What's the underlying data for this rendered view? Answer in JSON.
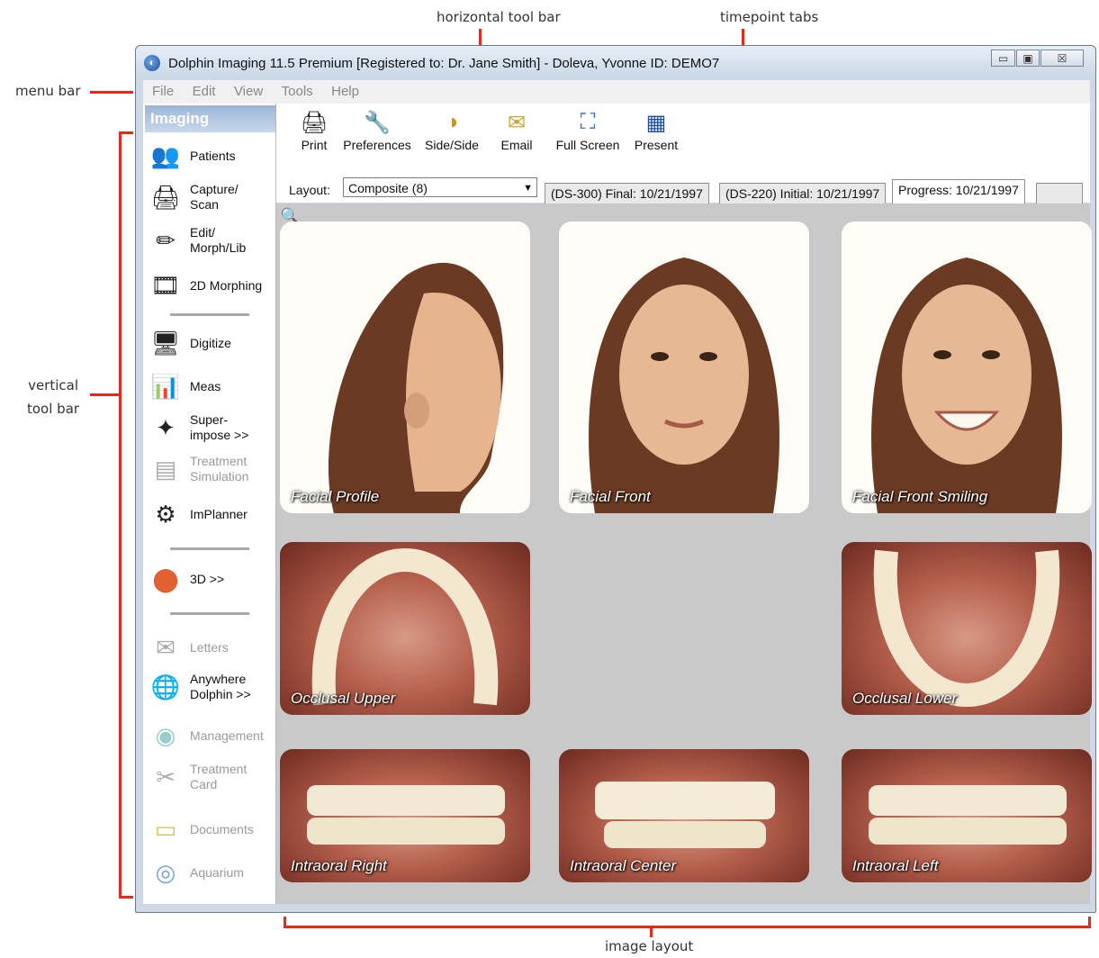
{
  "callouts": {
    "menu_bar": "menu bar",
    "horizontal_tool_bar": "horizontal tool bar",
    "timepoint_tabs": "timepoint tabs",
    "vertical_tool_bar": "vertical\ntool bar",
    "image_layout": "image layout"
  },
  "window": {
    "title": "Dolphin Imaging 11.5 Premium [Registered to: Dr. Jane Smith] - Doleva, Yvonne  ID: DEMO7",
    "app_icon": "dolphin-icon",
    "controls": {
      "minimize": "▭",
      "maximize": "▣",
      "close": "☒"
    }
  },
  "menu": [
    "File",
    "Edit",
    "View",
    "Tools",
    "Help"
  ],
  "sidebar": {
    "header": "Imaging",
    "items": [
      {
        "label": "Patients",
        "icon": "patients-icon",
        "glyph": "👥",
        "enabled": true
      },
      {
        "label": "Capture/\nScan",
        "icon": "scanner-icon",
        "glyph": "🖨",
        "enabled": true
      },
      {
        "label": "Edit/\nMorph/Lib",
        "icon": "pencils-icon",
        "glyph": "✏",
        "enabled": true
      },
      {
        "label": "2D Morphing",
        "icon": "morphing-icon",
        "glyph": "🎞",
        "enabled": true
      },
      {
        "label": "Digitize",
        "icon": "digitize-icon",
        "glyph": "🖥",
        "enabled": true
      },
      {
        "label": "Meas",
        "icon": "measurement-icon",
        "glyph": "📊",
        "enabled": true
      },
      {
        "label": "Super-\nimpose >>",
        "icon": "superimpose-icon",
        "glyph": "✦",
        "enabled": true
      },
      {
        "label": "Treatment\nSimulation",
        "icon": "simulation-icon",
        "glyph": "▤",
        "enabled": false
      },
      {
        "label": "ImPlanner",
        "icon": "implant-icon",
        "glyph": "⚙",
        "enabled": true
      },
      {
        "label": "3D >>",
        "icon": "3d-icon",
        "glyph": "⬤",
        "enabled": true
      },
      {
        "label": "Letters",
        "icon": "letters-icon",
        "glyph": "✉",
        "enabled": false
      },
      {
        "label": "Anywhere\nDolphin >>",
        "icon": "anywhere-icon",
        "glyph": "🌐",
        "enabled": true
      },
      {
        "label": "Management",
        "icon": "management-icon",
        "glyph": "◉",
        "enabled": false
      },
      {
        "label": "Treatment\nCard",
        "icon": "treatment-card-icon",
        "glyph": "✂",
        "enabled": false
      },
      {
        "label": "Documents",
        "icon": "documents-icon",
        "glyph": "▭",
        "enabled": false
      },
      {
        "label": "Aquarium",
        "icon": "aquarium-icon",
        "glyph": "◎",
        "enabled": false
      }
    ]
  },
  "toolbar": {
    "buttons": [
      {
        "label": "Print",
        "icon": "print-icon",
        "glyph": "🖨"
      },
      {
        "label": "Preferences",
        "icon": "wrench-icon",
        "glyph": "🔧"
      },
      {
        "label": "Side/Side",
        "icon": "side-by-side-icon",
        "glyph": "◑"
      },
      {
        "label": "Email",
        "icon": "email-icon",
        "glyph": "✉"
      },
      {
        "label": "Full Screen",
        "icon": "full-screen-icon",
        "glyph": "⛶"
      },
      {
        "label": "Present",
        "icon": "present-icon",
        "glyph": "▦"
      }
    ],
    "layout_label": "Layout:",
    "layout_value": "Composite (8)"
  },
  "tabs": [
    {
      "label": "(DS-300) Final: 10/21/1997",
      "active": false
    },
    {
      "label": "(DS-220) Initial: 10/21/1997",
      "active": false
    },
    {
      "label": "Progress: 10/21/1997",
      "active": true
    }
  ],
  "images": [
    {
      "caption": "Facial Profile",
      "kind": "face"
    },
    {
      "caption": "Facial Front",
      "kind": "face"
    },
    {
      "caption": "Facial Front Smiling",
      "kind": "face"
    },
    {
      "caption": "Occlusal Upper",
      "kind": "oral"
    },
    {
      "caption": "Occlusal Lower",
      "kind": "oral"
    },
    {
      "caption": "Intraoral Right",
      "kind": "oral"
    },
    {
      "caption": "Intraoral Center",
      "kind": "oral"
    },
    {
      "caption": "Intraoral Left",
      "kind": "oral"
    }
  ]
}
